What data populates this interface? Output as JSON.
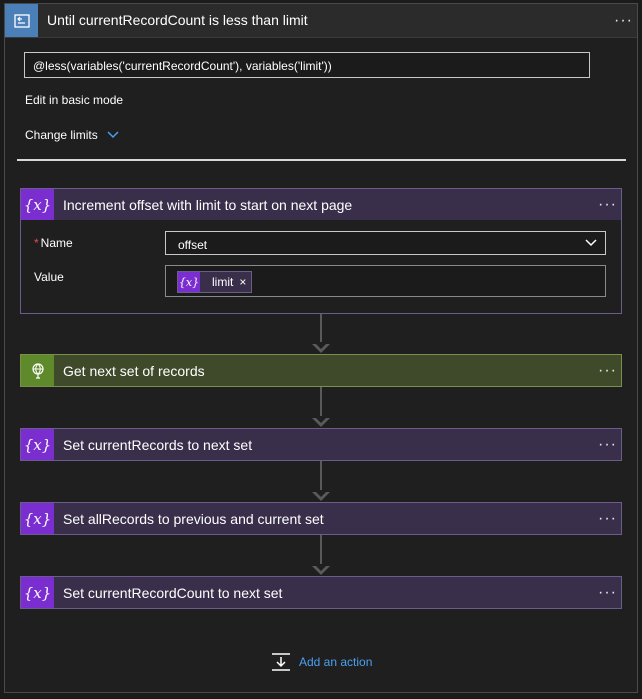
{
  "scope": {
    "title": "Until currentRecordCount is less than limit",
    "more": "···",
    "expression": "@less(variables('currentRecordCount'), variables('limit'))",
    "edit_basic": "Edit in basic mode",
    "change_limits": "Change limits"
  },
  "increment": {
    "icon_text": "{x}",
    "title": "Increment offset with limit to start on next page",
    "more": "···",
    "name_required_mark": "*",
    "name_label": "Name",
    "name_value": "offset",
    "value_label": "Value",
    "token_icon_text": "{x}",
    "token_label": "limit",
    "token_close": "×"
  },
  "get_next": {
    "title": "Get next set of records",
    "more": "···"
  },
  "set_current_records": {
    "icon_text": "{x}",
    "title": "Set currentRecords to next set",
    "more": "···"
  },
  "set_all_records": {
    "icon_text": "{x}",
    "title": "Set allRecords to previous and current set",
    "more": "···"
  },
  "set_record_count": {
    "icon_text": "{x}",
    "title": "Set currentRecordCount to next set",
    "more": "···"
  },
  "add_action": {
    "label": "Add an action"
  },
  "colors": {
    "loop_accent": "#4a7fb8",
    "variable_accent": "#7b2ecf",
    "http_accent": "#5f8a2c",
    "link": "#4aa0f0"
  }
}
